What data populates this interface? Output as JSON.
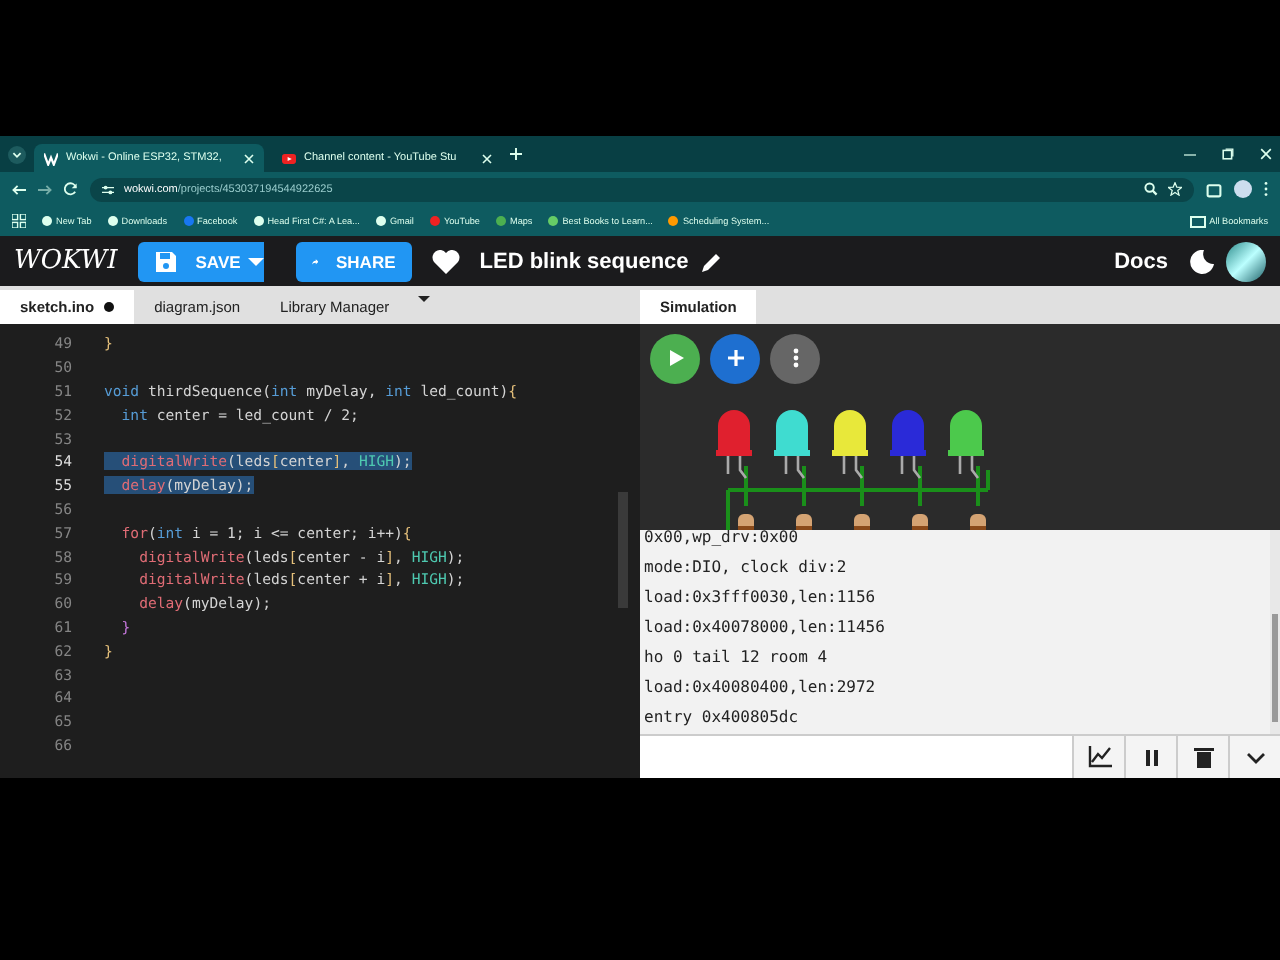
{
  "browser": {
    "tabs": [
      {
        "title": "Wokwi - Online ESP32, STM32,",
        "selected": true,
        "kind": "wokwi"
      },
      {
        "title": "Channel content - YouTube Stu",
        "selected": false,
        "kind": "youtube"
      }
    ],
    "url_host": "wokwi.com",
    "url_path": "/projects/453037194544922625",
    "bookmarks": [
      {
        "label": "New Tab",
        "kind": "globe"
      },
      {
        "label": "Downloads",
        "kind": "download"
      },
      {
        "label": "Facebook",
        "kind": "facebook"
      },
      {
        "label": "Head First C#: A Lea...",
        "kind": "globe"
      },
      {
        "label": "Gmail",
        "kind": "globe"
      },
      {
        "label": "YouTube",
        "kind": "youtube"
      },
      {
        "label": "Maps",
        "kind": "maps"
      },
      {
        "label": "Best Books to Learn...",
        "kind": "leaf"
      },
      {
        "label": "Scheduling System...",
        "kind": "cube"
      }
    ],
    "all_bookmarks": "All Bookmarks"
  },
  "header": {
    "logo": "WOKWI",
    "save": "SAVE",
    "share": "SHARE",
    "project_title": "LED blink sequence",
    "docs": "Docs"
  },
  "editor": {
    "tabs": [
      {
        "label": "sketch.ino",
        "selected": true,
        "modified": true
      },
      {
        "label": "diagram.json",
        "selected": false,
        "modified": false
      },
      {
        "label": "Library Manager",
        "selected": false,
        "modified": false
      }
    ],
    "lines": [
      {
        "number": "49",
        "selected": false,
        "tokens": [
          {
            "text": "}",
            "kind": "brace"
          }
        ]
      },
      {
        "number": "50",
        "selected": false
      },
      {
        "number": "51",
        "selected": false,
        "tokens": [
          {
            "text": "void ",
            "kind": "kw"
          },
          {
            "text": "thirdSequence(",
            "kind": "plain"
          },
          {
            "text": "int ",
            "kind": "kw"
          },
          {
            "text": "myDelay, ",
            "kind": "plain"
          },
          {
            "text": "int ",
            "kind": "kw"
          },
          {
            "text": "led_count)",
            "kind": "plain"
          },
          {
            "text": "{",
            "kind": "brace"
          }
        ]
      },
      {
        "number": "52",
        "selected": false,
        "tokens": [
          {
            "text": "  int ",
            "kind": "kw"
          },
          {
            "text": "center = led_count / 2;",
            "kind": "plain"
          }
        ]
      },
      {
        "number": "53",
        "selected": false
      },
      {
        "number": "54",
        "selected": true,
        "tokens": [
          {
            "text": "  digitalWrite",
            "kind": "fn"
          },
          {
            "text": "(leds",
            "kind": "plain"
          },
          {
            "text": "[",
            "kind": "bracket"
          },
          {
            "text": "center",
            "kind": "plain"
          },
          {
            "text": "]",
            "kind": "bracket"
          },
          {
            "text": ", ",
            "kind": "plain"
          },
          {
            "text": "HIGH",
            "kind": "const"
          },
          {
            "text": ");",
            "kind": "plain"
          }
        ]
      },
      {
        "number": "55",
        "selected": true,
        "tokens": [
          {
            "text": "  delay",
            "kind": "fn"
          },
          {
            "text": "(myDelay);",
            "kind": "plain"
          }
        ]
      },
      {
        "number": "56",
        "selected": false
      },
      {
        "number": "57",
        "selected": false,
        "tokens": [
          {
            "text": "  for",
            "kind": "fn"
          },
          {
            "text": "(",
            "kind": "plain"
          },
          {
            "text": "int ",
            "kind": "kw"
          },
          {
            "text": "i = 1; i <= center; i++)",
            "kind": "plain"
          },
          {
            "text": "{",
            "kind": "brace"
          }
        ]
      },
      {
        "number": "58",
        "selected": false,
        "tokens": [
          {
            "text": "    digitalWrite",
            "kind": "fn"
          },
          {
            "text": "(leds",
            "kind": "plain"
          },
          {
            "text": "[",
            "kind": "bracket"
          },
          {
            "text": "center - i",
            "kind": "plain"
          },
          {
            "text": "]",
            "kind": "bracket"
          },
          {
            "text": ", ",
            "kind": "plain"
          },
          {
            "text": "HIGH",
            "kind": "const"
          },
          {
            "text": ");",
            "kind": "plain"
          }
        ]
      },
      {
        "number": "59",
        "selected": false,
        "tokens": [
          {
            "text": "    digitalWrite",
            "kind": "fn"
          },
          {
            "text": "(leds",
            "kind": "plain"
          },
          {
            "text": "[",
            "kind": "bracket"
          },
          {
            "text": "center + i",
            "kind": "plain"
          },
          {
            "text": "]",
            "kind": "bracket"
          },
          {
            "text": ", ",
            "kind": "plain"
          },
          {
            "text": "HIGH",
            "kind": "const"
          },
          {
            "text": ");",
            "kind": "plain"
          }
        ]
      },
      {
        "number": "60",
        "selected": false,
        "tokens": [
          {
            "text": "    delay",
            "kind": "fn"
          },
          {
            "text": "(myDelay);",
            "kind": "plain"
          }
        ]
      },
      {
        "number": "61",
        "selected": false,
        "tokens": [
          {
            "text": "  }",
            "kind": "paren"
          }
        ]
      },
      {
        "number": "62",
        "selected": false,
        "tokens": [
          {
            "text": "}",
            "kind": "brace"
          }
        ]
      },
      {
        "number": "63",
        "selected": false
      },
      {
        "number": "64",
        "selected": false
      },
      {
        "number": "65",
        "selected": false
      },
      {
        "number": "66",
        "selected": false
      }
    ]
  },
  "simulation": {
    "tab": "Simulation",
    "leds": [
      {
        "color": "#e0202e"
      },
      {
        "color": "#3fdcd0"
      },
      {
        "color": "#e8e83a"
      },
      {
        "color": "#2a2ad8"
      },
      {
        "color": "#4cc94c"
      }
    ],
    "serial_lines": [
      "0x00,wp_drv:0x00",
      "mode:DIO, clock div:2",
      "load:0x3fff0030,len:1156",
      "load:0x40078000,len:11456",
      "ho 0 tail 12 room 4",
      "load:0x40080400,len:2972",
      "entry 0x400805dc"
    ]
  }
}
